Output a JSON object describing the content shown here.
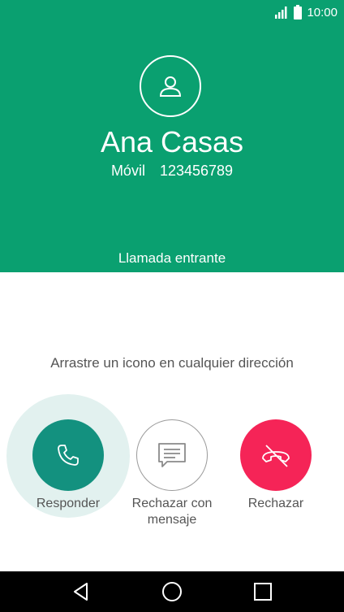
{
  "status": {
    "time": "10:00"
  },
  "contact": {
    "name": "Ana Casas",
    "type": "Móvil",
    "number": "123456789"
  },
  "call": {
    "state": "Llamada entrante"
  },
  "hint": "Arrastre un icono en cualquier dirección",
  "actions": {
    "answer": {
      "label": "Responder",
      "icon": "phone-icon"
    },
    "message": {
      "label": "Rechazar con mensaje",
      "icon": "message-icon"
    },
    "reject": {
      "label": "Rechazar",
      "icon": "hang-up-icon"
    }
  },
  "colors": {
    "header": "#0aa070",
    "answer": "#13917f",
    "reject": "#f52457"
  }
}
